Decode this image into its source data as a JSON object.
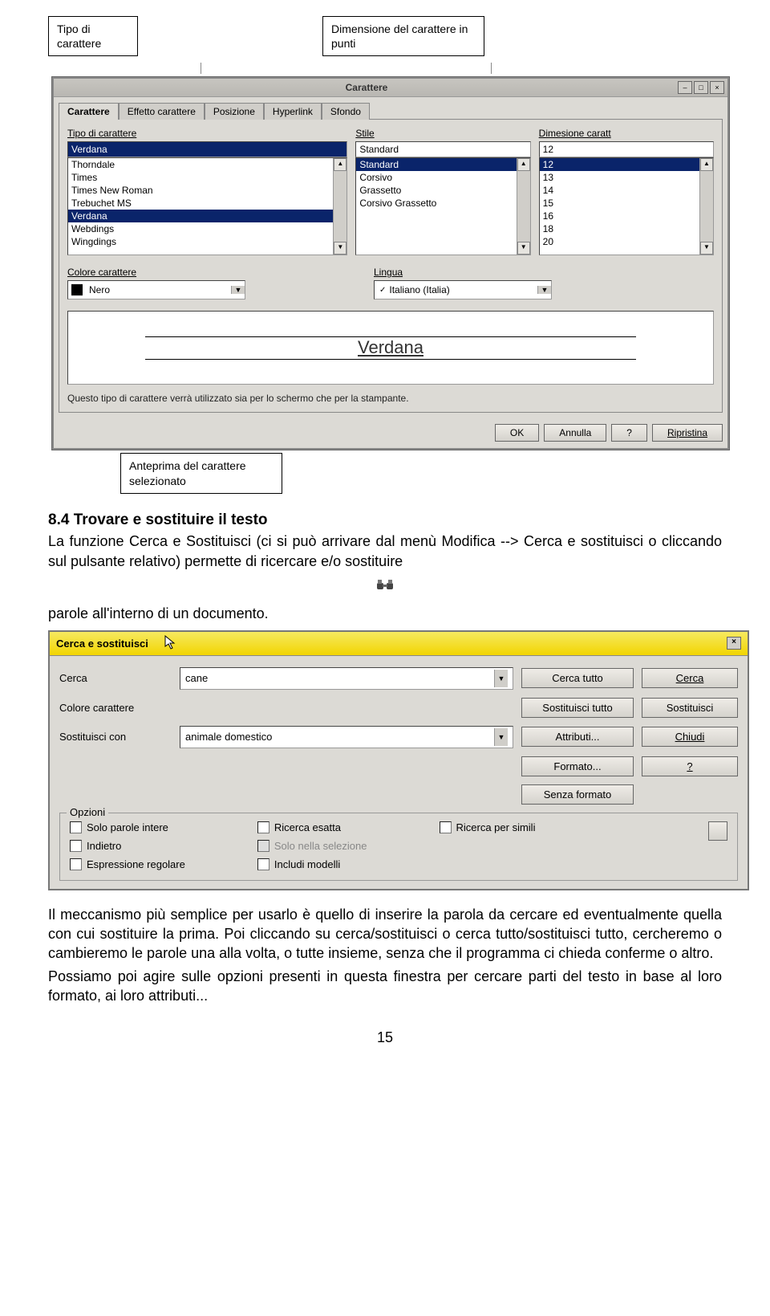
{
  "callouts": {
    "tipo": "Tipo di carattere",
    "dimensione": "Dimensione del carattere in punti",
    "anteprima": "Anteprima del carattere selezionato"
  },
  "dialog1": {
    "title": "Carattere",
    "tabs": [
      "Carattere",
      "Effetto carattere",
      "Posizione",
      "Hyperlink",
      "Sfondo"
    ],
    "labels": {
      "tipo": "Tipo di carattere",
      "stile": "Stile",
      "dim": "Dimesione caratt",
      "colore": "Colore carattere",
      "lingua": "Lingua"
    },
    "tipo_value": "Verdana",
    "stile_value": "Standard",
    "dim_value": "12",
    "font_list": [
      "Thorndale",
      "Times",
      "Times New Roman",
      "Trebuchet MS",
      "Verdana",
      "Webdings",
      "Wingdings"
    ],
    "stile_list": [
      "Standard",
      "Corsivo",
      "Grassetto",
      "Corsivo Grassetto"
    ],
    "dim_list": [
      "12",
      "13",
      "14",
      "15",
      "16",
      "18",
      "20"
    ],
    "colore_value": "Nero",
    "lingua_value": "Italiano (Italia)",
    "preview_text": "Verdana",
    "note": "Questo tipo di carattere verrà utilizzato sia per lo schermo che per la stampante.",
    "buttons": {
      "ok": "OK",
      "annulla": "Annulla",
      "help": "?",
      "ripristina": "Ripristina"
    }
  },
  "section": {
    "heading": "8.4 Trovare e sostituire il testo",
    "p1a": "La funzione Cerca e Sostituisci (ci si può arrivare dal menù Modifica --> Cerca e sostituisci o cliccando sul pulsante relativo) permette di ricercare e/o sostituire",
    "p1b": "parole all'interno di un documento.",
    "p2": "Il meccanismo più semplice per usarlo è quello di inserire la parola da cercare ed eventualmente quella con cui sostituire la prima. Poi cliccando su cerca/sostituisci o cerca tutto/sostituisci tutto, cercheremo o cambieremo le parole una alla volta, o tutte insieme, senza che il programma ci chieda conferme o altro.",
    "p3": "Possiamo poi agire sulle opzioni presenti in questa finestra per cercare parti del testo in base al loro formato, ai loro attributi..."
  },
  "dialog2": {
    "title": "Cerca e sostituisci",
    "labels": {
      "cerca": "Cerca",
      "colore": "Colore carattere",
      "sost_con": "Sostituisci con"
    },
    "cerca_value": "cane",
    "sost_value": "animale domestico",
    "buttons": {
      "cerca_tutto": "Cerca tutto",
      "cerca": "Cerca",
      "sost_tutto": "Sostituisci tutto",
      "sostituisci": "Sostituisci",
      "attributi": "Attributi...",
      "chiudi": "Chiudi",
      "formato": "Formato...",
      "help": "?",
      "senza_formato": "Senza formato"
    },
    "options_legend": "Opzioni",
    "opts": {
      "solo_parole": "Solo parole intere",
      "indietro": "Indietro",
      "espressione": "Espressione regolare",
      "ricerca_esatta": "Ricerca esatta",
      "solo_selezione": "Solo nella selezione",
      "includi_modelli": "Includi modelli",
      "ricerca_simili": "Ricerca per simili"
    }
  },
  "pagenum": "15"
}
